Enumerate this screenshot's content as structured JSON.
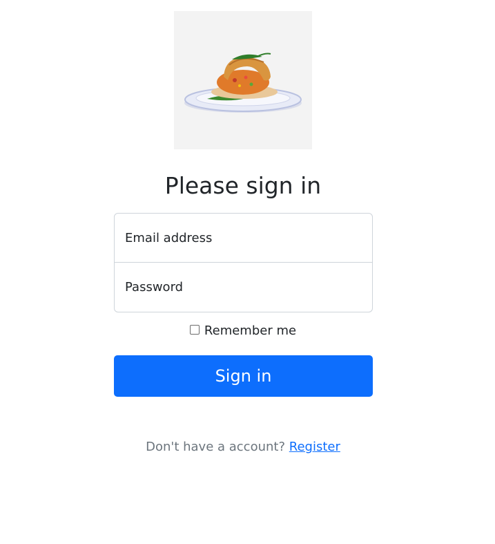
{
  "logo": {
    "icon": "vada-pav-on-plate"
  },
  "form": {
    "heading": "Please sign in",
    "email_placeholder": "Email address",
    "password_placeholder": "Password",
    "remember_label": "Remember me",
    "submit_label": "Sign in"
  },
  "footer": {
    "prompt": "Don't have a account?",
    "register_link": "Register"
  },
  "colors": {
    "primary": "#0d6efd",
    "muted_text": "#6c757d",
    "border": "#ced4da"
  }
}
